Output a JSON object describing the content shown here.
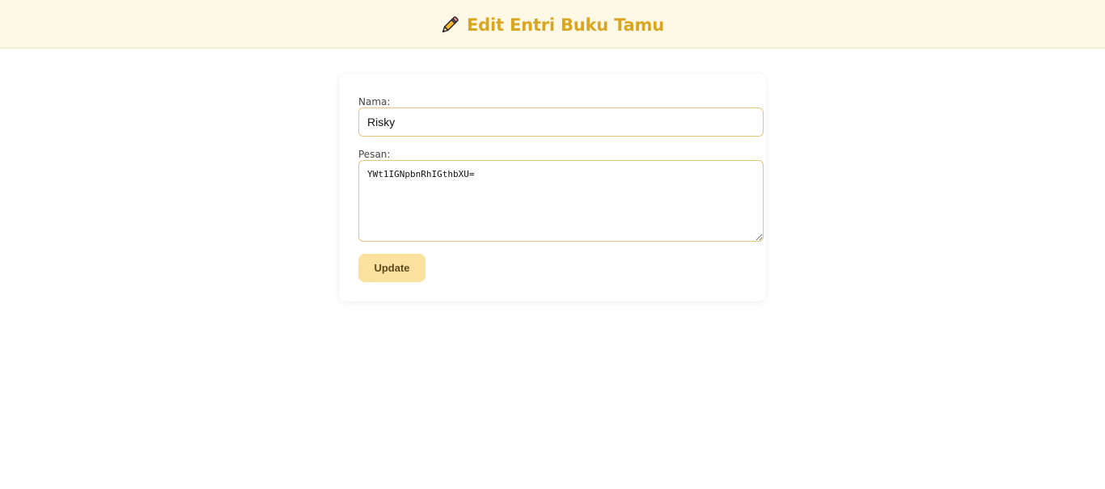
{
  "header": {
    "icon": "pencil-icon",
    "title": "Edit Entri Buku Tamu"
  },
  "form": {
    "nama_label": "Nama:",
    "nama_value": "Risky",
    "pesan_label": "Pesan:",
    "pesan_value": "YWt1IGNpbnRhIGthbXU=",
    "update_label": "Update"
  },
  "colors": {
    "accent": "#d9a621",
    "header_bg": "#fef9e7",
    "input_border": "#e3c77a",
    "button_bg": "#fbe19e"
  }
}
